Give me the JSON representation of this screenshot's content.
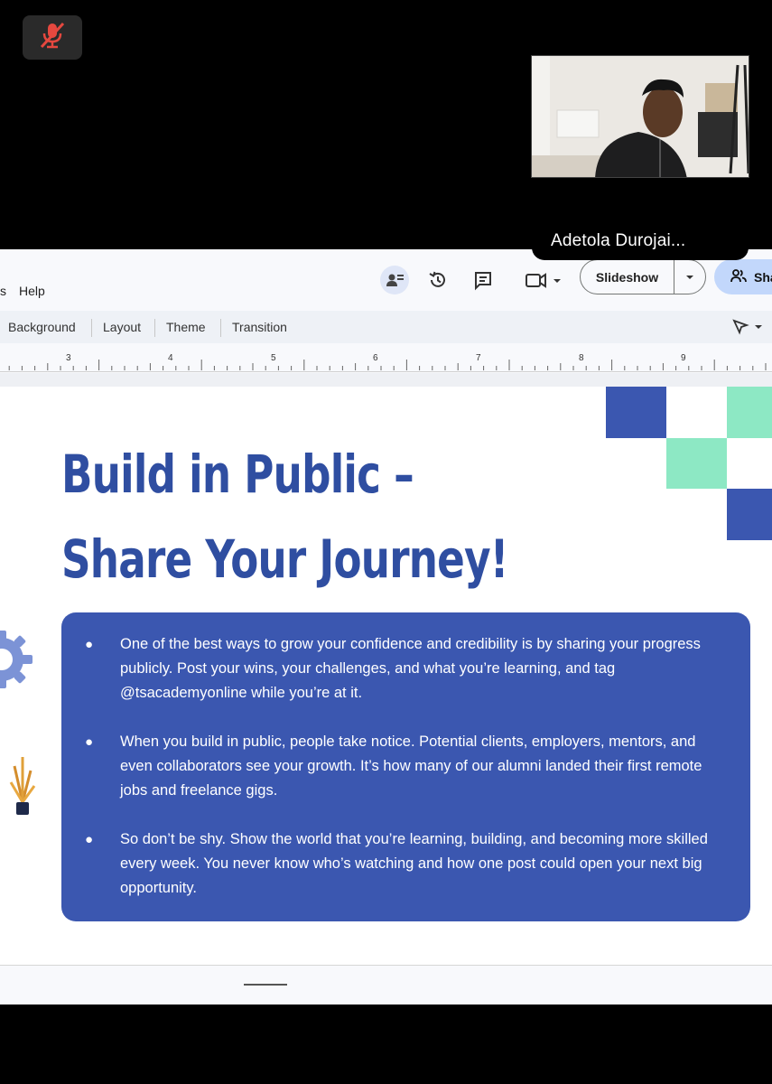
{
  "meeting": {
    "mute_icon": "microphone-muted-icon",
    "participant_name": "Adetola Durojai...",
    "colors": {
      "mute_red": "#e5483f"
    }
  },
  "menu": {
    "partial_item": "s",
    "help": "Help"
  },
  "header": {
    "slideshow_label": "Slideshow",
    "share_label": "Sha",
    "icons": [
      "present-to-chat-icon",
      "version-history-icon",
      "comment-icon",
      "video-camera-icon"
    ]
  },
  "toolbar": {
    "items": [
      "Background",
      "Layout",
      "Theme",
      "Transition"
    ]
  },
  "ruler": {
    "numbers": [
      "3",
      "4",
      "5",
      "6",
      "7",
      "8",
      "9"
    ]
  },
  "slide": {
    "title_line1": "Build in Public –",
    "title_line2": "Share Your Journey!",
    "bullets": [
      "One of the best ways to grow your confidence and credibility is by sharing your progress publicly. Post your wins, your challenges, and what you’re learning, and tag @tsacademyonline while you’re at it.",
      "When you build in public, people take notice. Potential clients, employers, mentors, and even collaborators see your growth. It’s how many of our alumni landed their first remote jobs and freelance gigs.",
      "So don’t be shy. Show the world that you’re learning, building, and becoming more skilled every week. You never know who’s watching and how one post could open your next big opportunity."
    ],
    "colors": {
      "blue": "#3b57b0",
      "title": "#2f4ea1",
      "mint": "#8de8c4"
    }
  }
}
